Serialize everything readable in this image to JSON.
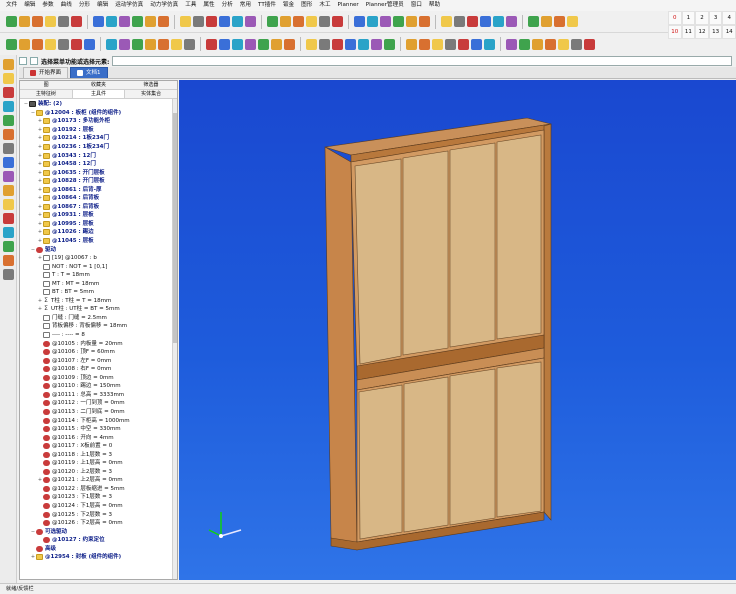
{
  "menu": [
    "文件",
    "编辑",
    "参数",
    "曲线",
    "分形",
    "编辑",
    "运动学仿真",
    "动力学仿真",
    "工具",
    "属性",
    "分析",
    "常用",
    "TT插件",
    "钣金",
    "图形",
    "木工",
    "Planner",
    "Planner管理员",
    "窗口",
    "帮助"
  ],
  "numpad": {
    "row1": [
      "0",
      "1",
      "2",
      "3",
      "4"
    ],
    "row2": [
      "10",
      "11",
      "12",
      "13",
      "14"
    ]
  },
  "command": {
    "label": "选择菜单功能或选择元素:",
    "value": ""
  },
  "doc_tabs": [
    "开始界面",
    "文档1"
  ],
  "panel": {
    "tabs_top": [
      "图",
      "收藏夹",
      "筛选器"
    ],
    "tabs_bottom": [
      "主特征树",
      "主具件",
      "实体集合"
    ]
  },
  "tree": [
    {
      "exp": "−",
      "icon": "root",
      "text": "装配: (2)",
      "level": 0,
      "cls": "blue"
    },
    {
      "exp": "−",
      "icon": "folder",
      "text": "@12004 : 板柜 (组件的组件)",
      "level": 1,
      "cls": "blue"
    },
    {
      "exp": "+",
      "icon": "folder",
      "text": "@10173 : 多功能外柜",
      "level": 2,
      "cls": "blue"
    },
    {
      "exp": "+",
      "icon": "folder",
      "text": "@10192 : 层板",
      "level": 2,
      "cls": "blue"
    },
    {
      "exp": "+",
      "icon": "folder",
      "text": "@10214 : 1板234门",
      "level": 2,
      "cls": "blue"
    },
    {
      "exp": "+",
      "icon": "folder",
      "text": "@10236 : 1板234门",
      "level": 2,
      "cls": "blue"
    },
    {
      "exp": "+",
      "icon": "folder",
      "text": "@10343 : 12门",
      "level": 2,
      "cls": "blue"
    },
    {
      "exp": "+",
      "icon": "folder",
      "text": "@10458 : 12门",
      "level": 2,
      "cls": "blue"
    },
    {
      "exp": "+",
      "icon": "folder",
      "text": "@10635 : 开门层板",
      "level": 2,
      "cls": "blue"
    },
    {
      "exp": "+",
      "icon": "folder",
      "text": "@10828 : 开门层板",
      "level": 2,
      "cls": "blue"
    },
    {
      "exp": "+",
      "icon": "folder",
      "text": "@10861 : 后背-厚",
      "level": 2,
      "cls": "blue"
    },
    {
      "exp": "+",
      "icon": "folder",
      "text": "@10864 : 后背板",
      "level": 2,
      "cls": "blue"
    },
    {
      "exp": "+",
      "icon": "folder",
      "text": "@10867 : 后背板",
      "level": 2,
      "cls": "blue"
    },
    {
      "exp": "+",
      "icon": "folder",
      "text": "@10931 : 层板",
      "level": 2,
      "cls": "blue"
    },
    {
      "exp": "+",
      "icon": "folder",
      "text": "@10995 : 层板",
      "level": 2,
      "cls": "blue"
    },
    {
      "exp": "+",
      "icon": "folder",
      "text": "@11026 : 踢边",
      "level": 2,
      "cls": "blue"
    },
    {
      "exp": "+",
      "icon": "folder",
      "text": "@11045 : 层板",
      "level": 2,
      "cls": "blue"
    },
    {
      "exp": "−",
      "icon": "gear",
      "text": "驱动",
      "level": 1,
      "cls": "blue"
    },
    {
      "exp": "+",
      "icon": "param",
      "text": "[19] @10067 : b",
      "level": 2,
      "cls": ""
    },
    {
      "exp": "",
      "icon": "param",
      "text": "NOT : NOT = 1 [0,1]",
      "level": 2,
      "cls": ""
    },
    {
      "exp": "",
      "icon": "param",
      "text": "T : T = 18mm",
      "level": 2,
      "cls": ""
    },
    {
      "exp": "",
      "icon": "param",
      "text": "MT : MT = 18mm",
      "level": 2,
      "cls": ""
    },
    {
      "exp": "",
      "icon": "param",
      "text": "BT : BT = 5mm",
      "level": 2,
      "cls": ""
    },
    {
      "exp": "+",
      "icon": "sum",
      "text": "T柱 : T柱 = T = 18mm",
      "level": 2,
      "cls": ""
    },
    {
      "exp": "+",
      "icon": "sum",
      "text": "UT柱 : UT柱 = BT = 5mm",
      "level": 2,
      "cls": ""
    },
    {
      "exp": "",
      "icon": "param",
      "text": "门缝 : 门缝 = 2.5mm",
      "level": 2,
      "cls": ""
    },
    {
      "exp": "",
      "icon": "param",
      "text": "背板偏移 : 背板偏移 = 18mm",
      "level": 2,
      "cls": ""
    },
    {
      "exp": "",
      "icon": "param",
      "text": "---- : ---- = 8",
      "level": 2,
      "cls": ""
    },
    {
      "exp": "",
      "icon": "gear",
      "text": "@10105 : 内板量 = 20mm",
      "level": 2,
      "cls": ""
    },
    {
      "exp": "",
      "icon": "gear",
      "text": "@10106 : 顶F = 60mm",
      "level": 2,
      "cls": ""
    },
    {
      "exp": "",
      "icon": "gear",
      "text": "@10107 : 左F = 0mm",
      "level": 2,
      "cls": ""
    },
    {
      "exp": "",
      "icon": "gear",
      "text": "@10108 : 右F = 0mm",
      "level": 2,
      "cls": ""
    },
    {
      "exp": "",
      "icon": "gear",
      "text": "@10109 : 顶边 = 0mm",
      "level": 2,
      "cls": ""
    },
    {
      "exp": "",
      "icon": "gear",
      "text": "@10110 : 踢边 = 150mm",
      "level": 2,
      "cls": ""
    },
    {
      "exp": "",
      "icon": "gear",
      "text": "@10111 : 总高 = 3333mm",
      "level": 2,
      "cls": ""
    },
    {
      "exp": "",
      "icon": "gear",
      "text": "@10112 : 一门到顶 = 0mm",
      "level": 2,
      "cls": ""
    },
    {
      "exp": "",
      "icon": "gear",
      "text": "@10113 : 二门到底 = 0mm",
      "level": 2,
      "cls": ""
    },
    {
      "exp": "",
      "icon": "gear",
      "text": "@10114 : 下柜高 = 1000mm",
      "level": 2,
      "cls": ""
    },
    {
      "exp": "",
      "icon": "gear",
      "text": "@10115 : 中空 = 330mm",
      "level": 2,
      "cls": ""
    },
    {
      "exp": "",
      "icon": "gear",
      "text": "@10116 : 开向 = 4mm",
      "level": 2,
      "cls": ""
    },
    {
      "exp": "",
      "icon": "gear",
      "text": "@10117 : X板前置 = 0",
      "level": 2,
      "cls": ""
    },
    {
      "exp": "",
      "icon": "gear",
      "text": "@10118 : 上1层数 = 3",
      "level": 2,
      "cls": ""
    },
    {
      "exp": "",
      "icon": "gear",
      "text": "@10119 : 上1层高 = 0mm",
      "level": 2,
      "cls": ""
    },
    {
      "exp": "",
      "icon": "gear",
      "text": "@10120 : 上2层数 = 3",
      "level": 2,
      "cls": ""
    },
    {
      "exp": "+",
      "icon": "gear",
      "text": "@10121 : 上2层高 = 0mm",
      "level": 2,
      "cls": ""
    },
    {
      "exp": "",
      "icon": "gear",
      "text": "@10122 : 层板缩进 = 5mm",
      "level": 2,
      "cls": ""
    },
    {
      "exp": "",
      "icon": "gear",
      "text": "@10123 : 下1层数 = 3",
      "level": 2,
      "cls": ""
    },
    {
      "exp": "",
      "icon": "gear",
      "text": "@10124 : 下1层高 = 0mm",
      "level": 2,
      "cls": ""
    },
    {
      "exp": "",
      "icon": "gear",
      "text": "@10125 : 下2层数 = 3",
      "level": 2,
      "cls": ""
    },
    {
      "exp": "",
      "icon": "gear",
      "text": "@10126 : 下2层高 = 0mm",
      "level": 2,
      "cls": ""
    },
    {
      "exp": "−",
      "icon": "gear",
      "text": "可选驱动",
      "level": 1,
      "cls": "blue"
    },
    {
      "exp": "",
      "icon": "gear",
      "text": "@10127 : 约束定位",
      "level": 2,
      "cls": "blue"
    },
    {
      "exp": "",
      "icon": "gear",
      "text": "高级",
      "level": 1,
      "cls": "blue"
    },
    {
      "exp": "+",
      "icon": "folder",
      "text": "@12954 : 封板 (组件的组件)",
      "level": 1,
      "cls": "blue"
    }
  ],
  "status": "就绪/反馈栏"
}
